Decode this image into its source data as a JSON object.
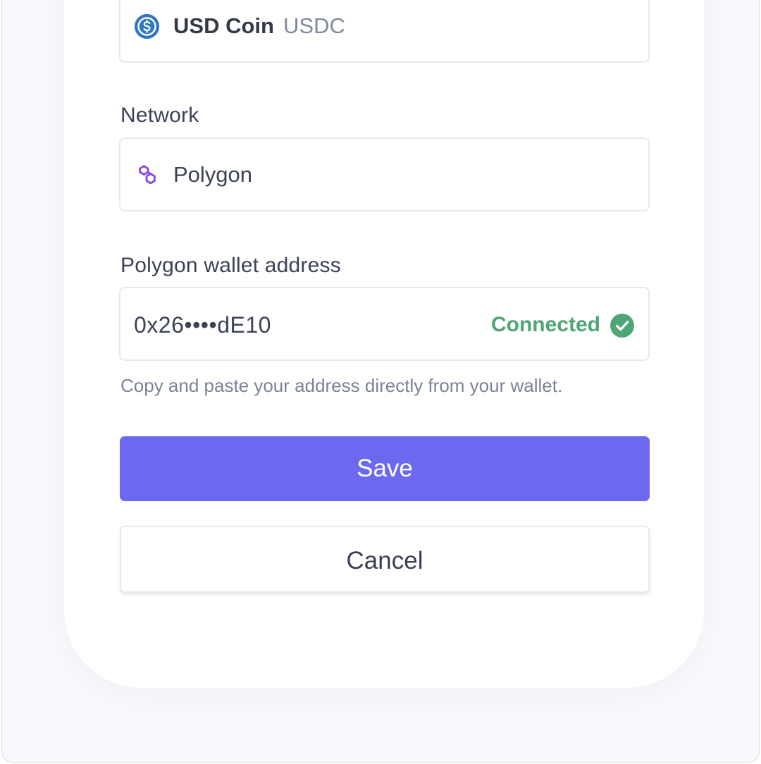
{
  "currency": {
    "name": "USD Coin",
    "ticker": "USDC",
    "icon": "usdc-coin-icon"
  },
  "network": {
    "label": "Network",
    "value": "Polygon",
    "icon": "polygon-icon"
  },
  "wallet": {
    "label": "Polygon wallet address",
    "value": "0x26••••dE10",
    "status": "Connected",
    "status_icon": "check-circle-icon",
    "hint": "Copy and paste your address directly from your wallet."
  },
  "actions": {
    "save_label": "Save",
    "cancel_label": "Cancel"
  },
  "colors": {
    "accent": "#6c68ef",
    "success": "#4ea575",
    "usdc_blue": "#2f76c4",
    "polygon_purple": "#8247e5"
  }
}
